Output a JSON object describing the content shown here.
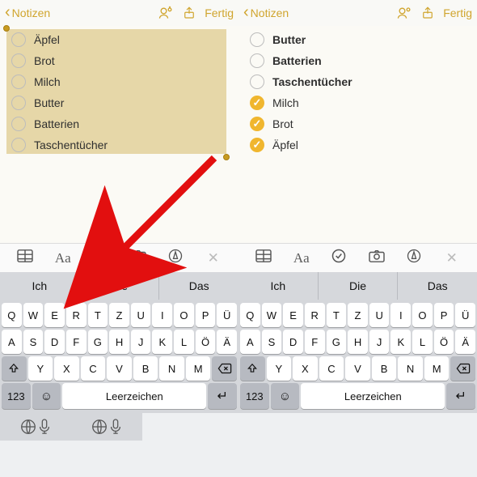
{
  "accent": "#d0a52e",
  "left": {
    "back_label": "Notizen",
    "done_label": "Fertig",
    "items": [
      {
        "text": "Äpfel",
        "checked": false
      },
      {
        "text": "Brot",
        "checked": false
      },
      {
        "text": "Milch",
        "checked": false
      },
      {
        "text": "Butter",
        "checked": false
      },
      {
        "text": "Batterien",
        "checked": false
      },
      {
        "text": "Taschentücher",
        "checked": false
      }
    ]
  },
  "right": {
    "back_label": "Notizen",
    "done_label": "Fertig",
    "items": [
      {
        "text": "Butter",
        "checked": false
      },
      {
        "text": "Batterien",
        "checked": false
      },
      {
        "text": "Taschentücher",
        "checked": false
      },
      {
        "text": "Milch",
        "checked": true
      },
      {
        "text": "Brot",
        "checked": true
      },
      {
        "text": "Äpfel",
        "checked": true
      }
    ]
  },
  "toolbar": {
    "aa_label": "Aa"
  },
  "suggestions": [
    "Ich",
    "Die",
    "Das"
  ],
  "keyboard": {
    "row1": [
      "Q",
      "W",
      "E",
      "R",
      "T",
      "Z",
      "U",
      "I",
      "O",
      "P",
      "Ü"
    ],
    "row2": [
      "A",
      "S",
      "D",
      "F",
      "G",
      "H",
      "J",
      "K",
      "L",
      "Ö",
      "Ä"
    ],
    "row3": [
      "Y",
      "X",
      "C",
      "V",
      "B",
      "N",
      "M"
    ],
    "num_label": "123",
    "space_label": "Leerzeichen"
  }
}
